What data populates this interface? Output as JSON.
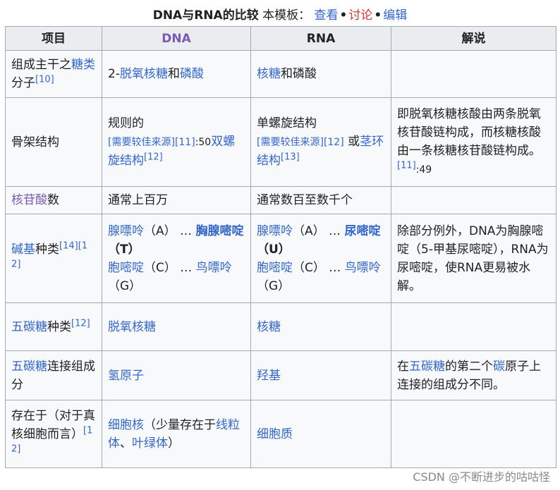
{
  "caption": {
    "title": "DNA与RNA的比较",
    "template_label": "本模板：",
    "links": [
      "查看",
      "讨论",
      "编辑"
    ],
    "dot": "•"
  },
  "headers": [
    "项目",
    "DNA",
    "RNA",
    "解说"
  ],
  "rows": {
    "sugar_backbone": {
      "label_a": "组成主干之",
      "label_link": "糖类",
      "label_b": "分子",
      "label_ref": "[10]",
      "dna_a": "2-",
      "dna_link1": "脱氧核糖",
      "dna_and": "和",
      "dna_link2": "磷酸",
      "rna_link": "核糖",
      "rna_rest": "和磷酸"
    },
    "backbone": {
      "label": "骨架结构",
      "dna_a": "规则的",
      "dna_note": "[需要较佳来源]",
      "dna_ref": "[11]",
      "dna_page": ":50",
      "dna_link": "双螺旋结构",
      "dna_ref2": "[12]",
      "rna_a": "单螺旋结构",
      "rna_note": "[需要较佳来源]",
      "rna_ref": "[12]",
      "rna_or": " 或",
      "rna_link": "茎环结构",
      "rna_ref2": "[13]",
      "explain": "即脱氧核糖核酸由两条脱氧核苷酸链构成，而核糖核酸由一条核糖核苷酸链构成。",
      "explain_ref": "[11]",
      "explain_page": ":49"
    },
    "nucleotides": {
      "label_link": "核苷酸",
      "label_b": "数",
      "dna": "通常上百万",
      "rna": "通常数百至数千个"
    },
    "bases": {
      "label_link": "碱基",
      "label_b": "种类",
      "label_ref1": "[14]",
      "label_ref2": "[12]",
      "dna_l1_link": "腺嘌呤",
      "dna_l1_code": "（A）",
      "dna_l1_dots": " … ",
      "dna_l1_pair": "胸腺嘧啶",
      "dna_l1_pair_code": "（T）",
      "dna_l2_link": "胞嘧啶",
      "dna_l2_code": "（C）",
      "dna_l2_dots": " … ",
      "dna_l2_pair": "鸟嘌呤",
      "dna_l2_pair_code": "（G）",
      "rna_l1_link": "腺嘌呤",
      "rna_l1_code": "（A）",
      "rna_l1_dots": " … ",
      "rna_l1_pair": "尿嘧啶",
      "rna_l1_pair_code": "（U）",
      "rna_l2_link": "胞嘧啶",
      "rna_l2_code": "（C）",
      "rna_l2_dots": " … ",
      "rna_l2_pair": "鸟嘌呤",
      "rna_l2_pair_code": "（G）",
      "explain": "除部分例外，DNA为胸腺嘧啶（5-甲基尿嘧啶），RNA为尿嘧啶，使RNA更易被水解。"
    },
    "pentose": {
      "label_link": "五碳糖",
      "label_b": "种类",
      "label_ref": "[12]",
      "dna": "脱氧核糖",
      "rna": "核糖"
    },
    "pentose_link": {
      "label_link": "五碳糖",
      "label_b": "连接组成分",
      "dna": "氢原子",
      "rna": "羟基",
      "explain_a": "在",
      "explain_link1": "五碳糖",
      "explain_b": "的第二个",
      "explain_link2": "碳",
      "explain_c": "原子上连接的组成分不同。"
    },
    "location": {
      "label": "存在于（对于真核细胞而言）",
      "label_ref": "[12]",
      "dna_link": "细胞核",
      "dna_a": "（少量存在于",
      "dna_link2": "线粒体",
      "dna_sep": "、",
      "dna_link3": "叶绿体",
      "dna_b": "）",
      "rna_link": "细胞质"
    }
  },
  "watermark": "CSDN @不断进步的咕咕怪",
  "colors": {
    "link": "#3366cc",
    "visited": "#795cb2",
    "red_link": "#d73333",
    "header_bg": "#eaecf0",
    "cell_bg": "#f8f9fa",
    "border": "#a2a9b1"
  }
}
